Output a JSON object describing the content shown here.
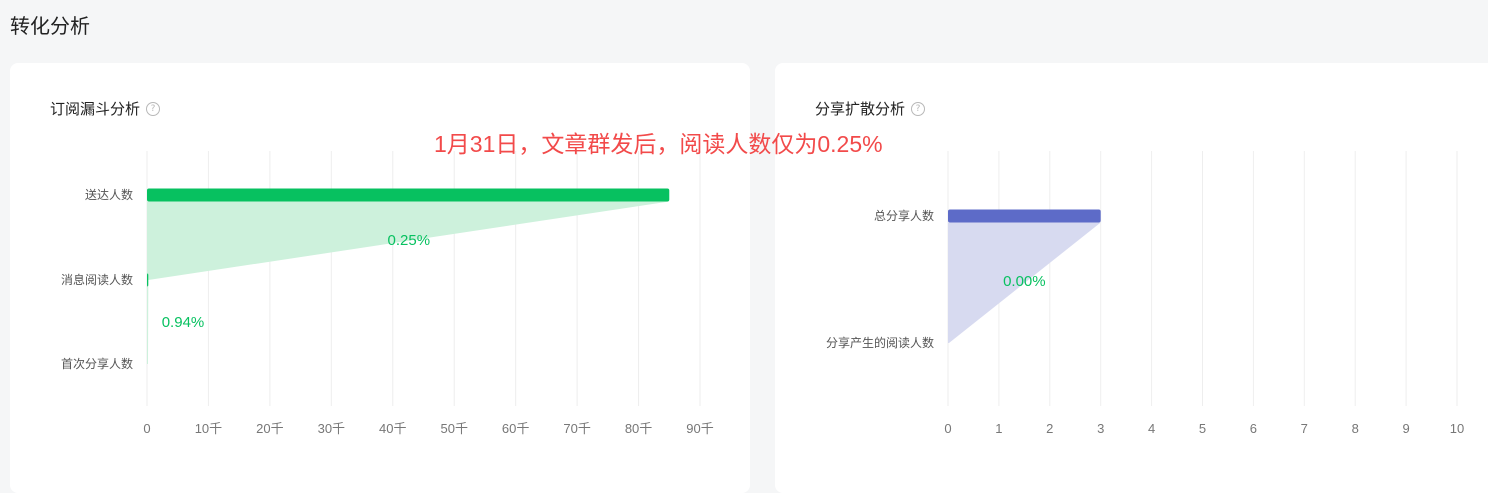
{
  "page": {
    "title": "转化分析"
  },
  "annotation": "1月31日，文章群发后，阅读人数仅为0.25%",
  "colors": {
    "green": "#07c160",
    "green_fill": "#cdf1dc",
    "blue": "#5d6bc8",
    "blue_fill": "#d7daf0",
    "grid": "#eeeeee",
    "label": "#555555",
    "rate": "#07c160"
  },
  "chart_data": [
    {
      "type": "bar",
      "title": "订阅漏斗分析",
      "orientation": "horizontal",
      "categories": [
        "送达人数",
        "消息阅读人数",
        "首次分享人数"
      ],
      "values": [
        85000,
        212,
        2
      ],
      "conversion_rates": [
        "0.25%",
        "0.94%"
      ],
      "x_ticks": [
        0,
        10000,
        20000,
        30000,
        40000,
        50000,
        60000,
        70000,
        80000,
        90000
      ],
      "x_tick_labels": [
        "0",
        "10千",
        "20千",
        "30千",
        "40千",
        "50千",
        "60千",
        "70千",
        "80千",
        "90千"
      ],
      "xlim": [
        0,
        90000
      ],
      "grid": true,
      "color": "#07c160"
    },
    {
      "type": "bar",
      "title": "分享扩散分析",
      "orientation": "horizontal",
      "categories": [
        "总分享人数",
        "分享产生的阅读人数"
      ],
      "values": [
        3,
        0
      ],
      "conversion_rates": [
        "0.00%"
      ],
      "x_ticks": [
        0,
        1,
        2,
        3,
        4,
        5,
        6,
        7,
        8,
        9,
        10
      ],
      "x_tick_labels": [
        "0",
        "1",
        "2",
        "3",
        "4",
        "5",
        "6",
        "7",
        "8",
        "9",
        "10"
      ],
      "xlim": [
        0,
        10
      ],
      "grid": true,
      "color": "#5d6bc8"
    }
  ]
}
